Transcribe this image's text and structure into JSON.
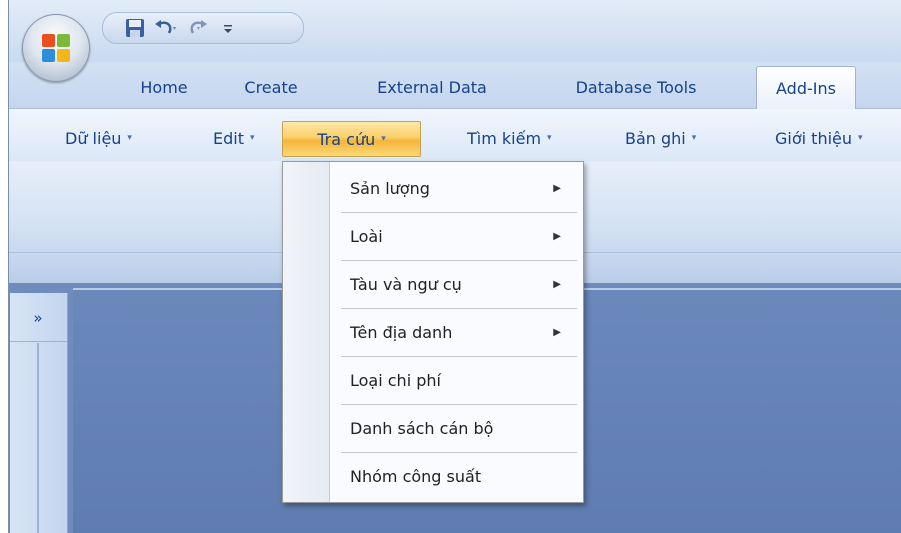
{
  "quick_access": {
    "icons": [
      "office-button-icon",
      "save-icon",
      "undo-icon",
      "redo-icon",
      "customize-icon"
    ]
  },
  "tabs": [
    {
      "label": "Home"
    },
    {
      "label": "Create"
    },
    {
      "label": "External Data"
    },
    {
      "label": "Database Tools"
    },
    {
      "label": "Add-Ins",
      "active": true
    }
  ],
  "ribbon_menus": [
    {
      "label": "Dữ liệu"
    },
    {
      "label": "Edit"
    },
    {
      "label": "Tra cứu",
      "active": true
    },
    {
      "label": "Tìm kiếm"
    },
    {
      "label": "Bản ghi"
    },
    {
      "label": "Giới thiệu"
    }
  ],
  "dropdown_arrow": "▾",
  "nav_pane": {
    "toggle": "»"
  },
  "menu": {
    "items": [
      {
        "label": "Sản lượng",
        "submenu": true
      },
      {
        "label": "Loài",
        "submenu": true
      },
      {
        "label": "Tàu và ngư cụ",
        "submenu": true
      },
      {
        "label": "Tên địa danh",
        "submenu": true
      },
      {
        "label": "Loại chi phí",
        "submenu": false
      },
      {
        "label": "Danh sách cán bộ",
        "submenu": false
      },
      {
        "label": "Nhóm công suất",
        "submenu": false
      }
    ],
    "submenu_arrow": "▶"
  },
  "colors": {
    "accent_text": "#15428b",
    "active_button": "#fbd06a",
    "workspace": "#6b88bb"
  }
}
